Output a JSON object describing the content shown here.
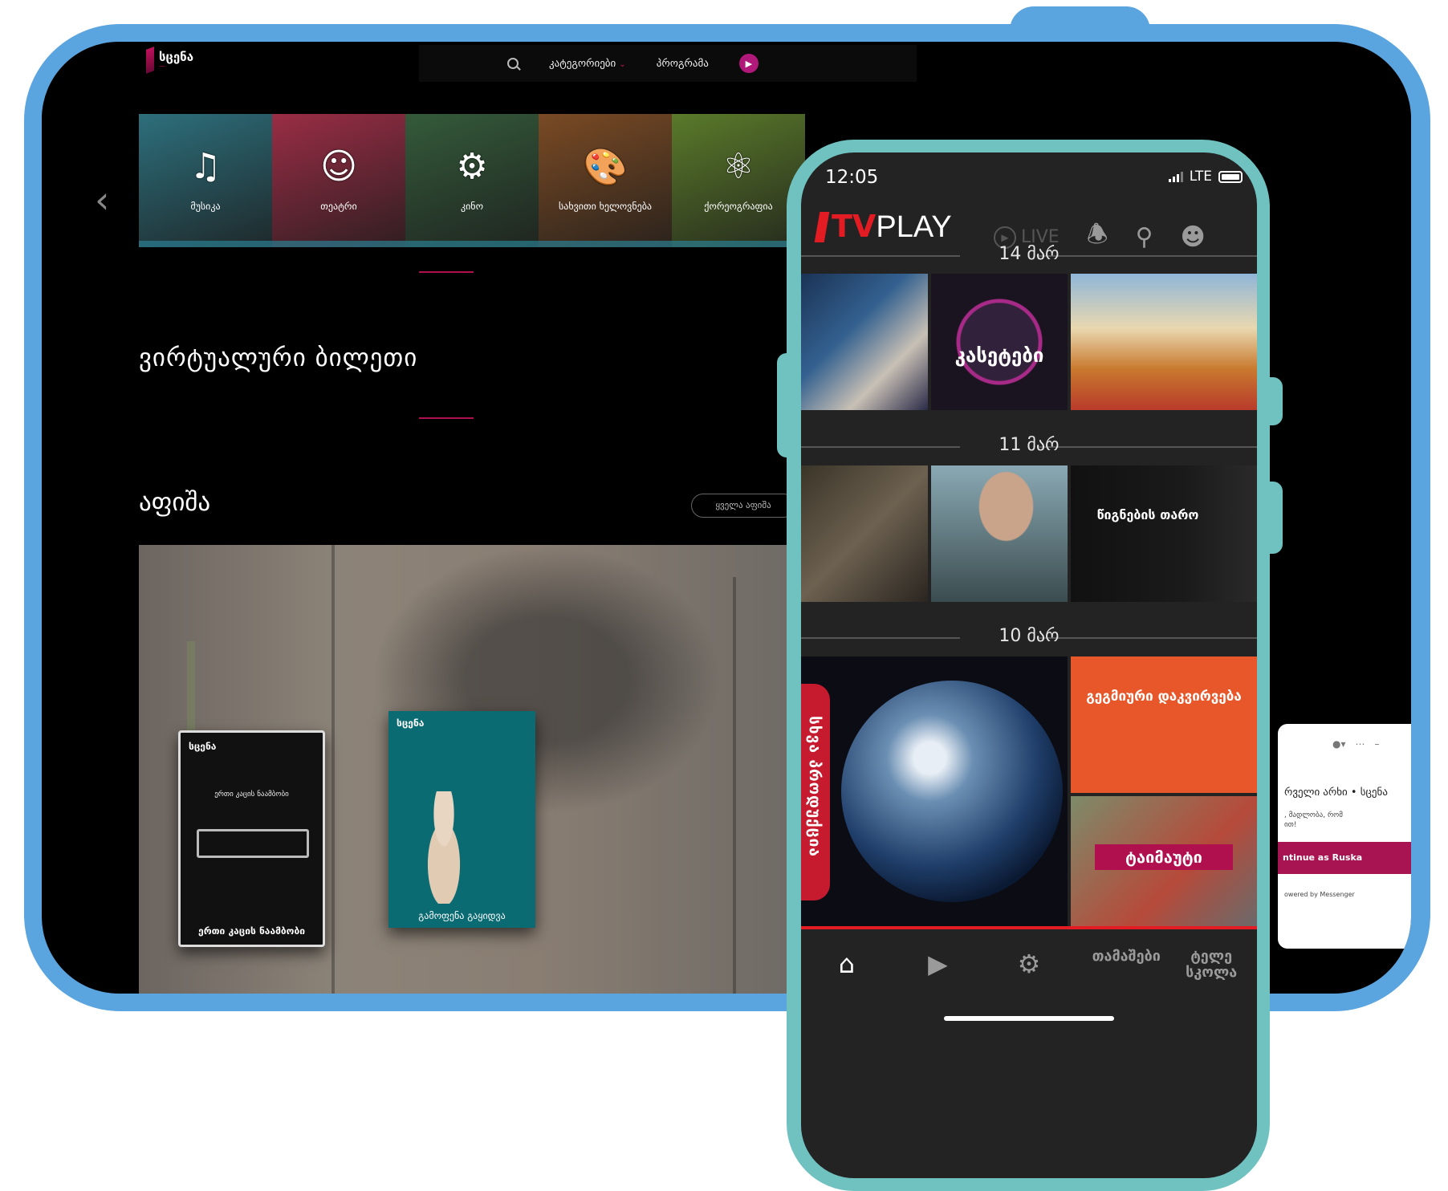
{
  "site": {
    "logo_text": "სცენა",
    "nav": {
      "categories": "კატეგორიები",
      "programs": "პროგრამა"
    },
    "categories": [
      {
        "label": "მუსიკა",
        "icon": "music-notes-icon",
        "color": "#2d6f7c"
      },
      {
        "label": "თეატრი",
        "icon": "theatre-masks-icon",
        "color": "#9a2d45"
      },
      {
        "label": "კინო",
        "icon": "film-projector-icon",
        "color": "#345a3a"
      },
      {
        "label": "სახვითი ხელოვნება",
        "icon": "palette-icon",
        "color": "#7a4a24"
      },
      {
        "label": "ქორეოგრაფია",
        "icon": "dancer-icon",
        "color": "#5a7a2a"
      }
    ],
    "virtual_ticket": "ვირტუალური ბილეთი",
    "afisha": "აფიშა",
    "see_all": "ყველა აფიშა",
    "poster_a": {
      "logo": "სცენა",
      "title": "ერთი კაცის ნაამბობი",
      "bottom": "ერთი კაცის ნაამბობი"
    },
    "poster_b": {
      "logo": "სცენა",
      "bottom": "გამოფენა გაყიდვა"
    }
  },
  "messenger": {
    "text": "რველი არხი • სცენა",
    "sub_line1": ", მადლობა, რომ",
    "sub_line2": "ით!",
    "button": "ntinue as Ruska",
    "powered": "owered by Messenger"
  },
  "phone": {
    "time": "12:05",
    "network": "LTE",
    "app_tv": "TV",
    "app_play": "PLAY",
    "live": "LIVE",
    "dates": [
      "14 მარ",
      "11 მარ",
      "10 მარ"
    ],
    "thumb_captions": {
      "kaseti": "კასეტები",
      "reading": "წიგნების თარო",
      "investigation": "გეგმიური დაკვირვება",
      "timeout": "ტაიმაუტი"
    },
    "side_tab": "სხვა პროდუქცია",
    "tabs": {
      "home_icon": "home-icon",
      "video_icon": "play-video-icon",
      "film_icon": "film-reel-icon",
      "games": "თამაშები",
      "tv": "ტელე სკოლა"
    }
  },
  "colors": {
    "accent_red": "#e31b23",
    "tablet_frame": "#5aa4e0",
    "phone_frame": "#70c2c0",
    "brand_magenta": "#a81352"
  }
}
